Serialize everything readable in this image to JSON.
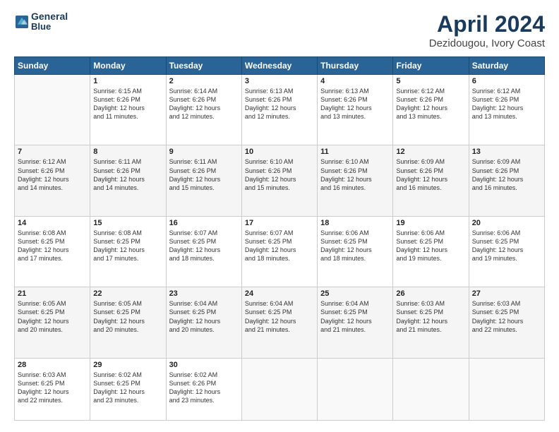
{
  "header": {
    "logo_line1": "General",
    "logo_line2": "Blue",
    "title": "April 2024",
    "subtitle": "Dezidougou, Ivory Coast"
  },
  "calendar": {
    "days_of_week": [
      "Sunday",
      "Monday",
      "Tuesday",
      "Wednesday",
      "Thursday",
      "Friday",
      "Saturday"
    ],
    "weeks": [
      [
        {
          "day": "",
          "info": ""
        },
        {
          "day": "1",
          "info": "Sunrise: 6:15 AM\nSunset: 6:26 PM\nDaylight: 12 hours\nand 11 minutes."
        },
        {
          "day": "2",
          "info": "Sunrise: 6:14 AM\nSunset: 6:26 PM\nDaylight: 12 hours\nand 12 minutes."
        },
        {
          "day": "3",
          "info": "Sunrise: 6:13 AM\nSunset: 6:26 PM\nDaylight: 12 hours\nand 12 minutes."
        },
        {
          "day": "4",
          "info": "Sunrise: 6:13 AM\nSunset: 6:26 PM\nDaylight: 12 hours\nand 13 minutes."
        },
        {
          "day": "5",
          "info": "Sunrise: 6:12 AM\nSunset: 6:26 PM\nDaylight: 12 hours\nand 13 minutes."
        },
        {
          "day": "6",
          "info": "Sunrise: 6:12 AM\nSunset: 6:26 PM\nDaylight: 12 hours\nand 13 minutes."
        }
      ],
      [
        {
          "day": "7",
          "info": "Sunrise: 6:12 AM\nSunset: 6:26 PM\nDaylight: 12 hours\nand 14 minutes."
        },
        {
          "day": "8",
          "info": "Sunrise: 6:11 AM\nSunset: 6:26 PM\nDaylight: 12 hours\nand 14 minutes."
        },
        {
          "day": "9",
          "info": "Sunrise: 6:11 AM\nSunset: 6:26 PM\nDaylight: 12 hours\nand 15 minutes."
        },
        {
          "day": "10",
          "info": "Sunrise: 6:10 AM\nSunset: 6:26 PM\nDaylight: 12 hours\nand 15 minutes."
        },
        {
          "day": "11",
          "info": "Sunrise: 6:10 AM\nSunset: 6:26 PM\nDaylight: 12 hours\nand 16 minutes."
        },
        {
          "day": "12",
          "info": "Sunrise: 6:09 AM\nSunset: 6:26 PM\nDaylight: 12 hours\nand 16 minutes."
        },
        {
          "day": "13",
          "info": "Sunrise: 6:09 AM\nSunset: 6:26 PM\nDaylight: 12 hours\nand 16 minutes."
        }
      ],
      [
        {
          "day": "14",
          "info": "Sunrise: 6:08 AM\nSunset: 6:25 PM\nDaylight: 12 hours\nand 17 minutes."
        },
        {
          "day": "15",
          "info": "Sunrise: 6:08 AM\nSunset: 6:25 PM\nDaylight: 12 hours\nand 17 minutes."
        },
        {
          "day": "16",
          "info": "Sunrise: 6:07 AM\nSunset: 6:25 PM\nDaylight: 12 hours\nand 18 minutes."
        },
        {
          "day": "17",
          "info": "Sunrise: 6:07 AM\nSunset: 6:25 PM\nDaylight: 12 hours\nand 18 minutes."
        },
        {
          "day": "18",
          "info": "Sunrise: 6:06 AM\nSunset: 6:25 PM\nDaylight: 12 hours\nand 18 minutes."
        },
        {
          "day": "19",
          "info": "Sunrise: 6:06 AM\nSunset: 6:25 PM\nDaylight: 12 hours\nand 19 minutes."
        },
        {
          "day": "20",
          "info": "Sunrise: 6:06 AM\nSunset: 6:25 PM\nDaylight: 12 hours\nand 19 minutes."
        }
      ],
      [
        {
          "day": "21",
          "info": "Sunrise: 6:05 AM\nSunset: 6:25 PM\nDaylight: 12 hours\nand 20 minutes."
        },
        {
          "day": "22",
          "info": "Sunrise: 6:05 AM\nSunset: 6:25 PM\nDaylight: 12 hours\nand 20 minutes."
        },
        {
          "day": "23",
          "info": "Sunrise: 6:04 AM\nSunset: 6:25 PM\nDaylight: 12 hours\nand 20 minutes."
        },
        {
          "day": "24",
          "info": "Sunrise: 6:04 AM\nSunset: 6:25 PM\nDaylight: 12 hours\nand 21 minutes."
        },
        {
          "day": "25",
          "info": "Sunrise: 6:04 AM\nSunset: 6:25 PM\nDaylight: 12 hours\nand 21 minutes."
        },
        {
          "day": "26",
          "info": "Sunrise: 6:03 AM\nSunset: 6:25 PM\nDaylight: 12 hours\nand 21 minutes."
        },
        {
          "day": "27",
          "info": "Sunrise: 6:03 AM\nSunset: 6:25 PM\nDaylight: 12 hours\nand 22 minutes."
        }
      ],
      [
        {
          "day": "28",
          "info": "Sunrise: 6:03 AM\nSunset: 6:25 PM\nDaylight: 12 hours\nand 22 minutes."
        },
        {
          "day": "29",
          "info": "Sunrise: 6:02 AM\nSunset: 6:25 PM\nDaylight: 12 hours\nand 23 minutes."
        },
        {
          "day": "30",
          "info": "Sunrise: 6:02 AM\nSunset: 6:26 PM\nDaylight: 12 hours\nand 23 minutes."
        },
        {
          "day": "",
          "info": ""
        },
        {
          "day": "",
          "info": ""
        },
        {
          "day": "",
          "info": ""
        },
        {
          "day": "",
          "info": ""
        }
      ]
    ]
  }
}
